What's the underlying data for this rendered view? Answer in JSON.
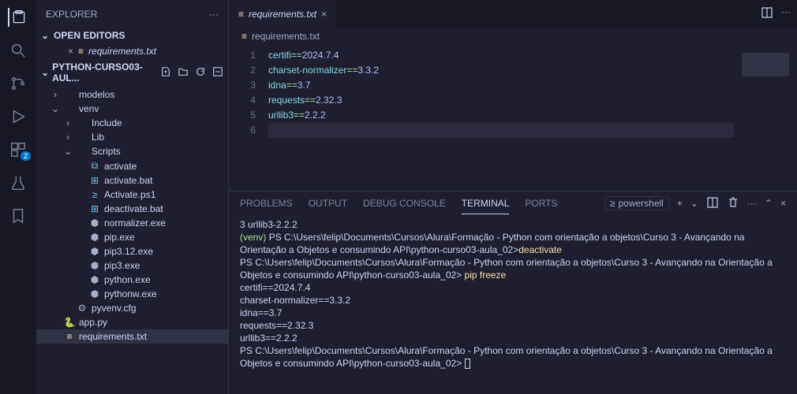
{
  "explorer": {
    "title": "EXPLORER",
    "openEditors": {
      "label": "OPEN EDITORS"
    },
    "openEditorsItems": [
      {
        "name": "requirements.txt"
      }
    ],
    "project": "PYTHON-CURSO03-AUL...",
    "tree": [
      {
        "lvl": 1,
        "chev": "›",
        "icon": "",
        "name": "modelos",
        "type": "folder"
      },
      {
        "lvl": 1,
        "chev": "⌄",
        "icon": "",
        "name": "venv",
        "type": "folder"
      },
      {
        "lvl": 2,
        "chev": "›",
        "icon": "",
        "name": "Include",
        "type": "folder"
      },
      {
        "lvl": 2,
        "chev": "›",
        "icon": "",
        "name": "Lib",
        "type": "folder"
      },
      {
        "lvl": 2,
        "chev": "⌄",
        "icon": "",
        "name": "Scripts",
        "type": "folder"
      },
      {
        "lvl": 3,
        "chev": "",
        "icon": "⧉",
        "iconColor": "#74c7ec",
        "name": "activate",
        "type": "file"
      },
      {
        "lvl": 3,
        "chev": "",
        "icon": "⊞",
        "iconColor": "#74c7ec",
        "name": "activate.bat",
        "type": "file"
      },
      {
        "lvl": 3,
        "chev": "",
        "icon": "≥",
        "iconColor": "#74c7ec",
        "name": "Activate.ps1",
        "type": "file"
      },
      {
        "lvl": 3,
        "chev": "",
        "icon": "⊞",
        "iconColor": "#74c7ec",
        "name": "deactivate.bat",
        "type": "file"
      },
      {
        "lvl": 3,
        "chev": "",
        "icon": "⬢",
        "iconColor": "#a6adc8",
        "name": "normalizer.exe",
        "type": "file"
      },
      {
        "lvl": 3,
        "chev": "",
        "icon": "⬢",
        "iconColor": "#a6adc8",
        "name": "pip.exe",
        "type": "file"
      },
      {
        "lvl": 3,
        "chev": "",
        "icon": "⬢",
        "iconColor": "#a6adc8",
        "name": "pip3.12.exe",
        "type": "file"
      },
      {
        "lvl": 3,
        "chev": "",
        "icon": "⬢",
        "iconColor": "#a6adc8",
        "name": "pip3.exe",
        "type": "file"
      },
      {
        "lvl": 3,
        "chev": "",
        "icon": "⬢",
        "iconColor": "#a6adc8",
        "name": "python.exe",
        "type": "file"
      },
      {
        "lvl": 3,
        "chev": "",
        "icon": "⬢",
        "iconColor": "#a6adc8",
        "name": "pythonw.exe",
        "type": "file"
      },
      {
        "lvl": 2,
        "chev": "",
        "icon": "⚙",
        "iconColor": "#a6adc8",
        "name": "pyvenv.cfg",
        "type": "file"
      },
      {
        "lvl": 1,
        "chev": "",
        "icon": "🐍",
        "iconColor": "#f9e2af",
        "name": "app.py",
        "type": "file"
      },
      {
        "lvl": 1,
        "chev": "",
        "icon": "≡",
        "iconColor": "#f9e2af",
        "name": "requirements.txt",
        "type": "file",
        "selected": true
      }
    ]
  },
  "editor": {
    "tab": {
      "name": "requirements.txt"
    },
    "breadcrumb": "requirements.txt",
    "lines": [
      {
        "n": 1,
        "pkg": "certifi",
        "op": "==",
        "ver": "2024.7.4"
      },
      {
        "n": 2,
        "pkg": "charset-normalizer",
        "op": "==",
        "ver": "3.3.2"
      },
      {
        "n": 3,
        "pkg": "idna",
        "op": "==",
        "ver": "3.7"
      },
      {
        "n": 4,
        "pkg": "requests",
        "op": "==",
        "ver": "2.32.3"
      },
      {
        "n": 5,
        "pkg": "urllib3",
        "op": "==",
        "ver": "2.2.2"
      },
      {
        "n": 6,
        "pkg": "",
        "op": "",
        "ver": "",
        "current": true
      }
    ]
  },
  "panel": {
    "tabs": {
      "problems": "PROBLEMS",
      "output": "OUTPUT",
      "debug": "DEBUG CONSOLE",
      "terminal": "TERMINAL",
      "ports": "PORTS"
    },
    "shell": "powershell",
    "terminalLines": [
      {
        "segments": [
          {
            "text": "3 urllib3-2.2.2"
          }
        ]
      },
      {
        "segments": [
          {
            "text": "(venv) ",
            "cls": "t-green"
          },
          {
            "text": "PS C:\\Users\\felip\\Documents\\Cursos\\Alura\\Formação - Python com orientação a objetos\\Curso 3 - Avançando na Orientação a Objetos e consumindo API\\python-curso03-aula_02>"
          },
          {
            "text": "deactivate",
            "cls": "t-yellow"
          }
        ]
      },
      {
        "segments": [
          {
            "text": "PS C:\\Users\\felip\\Documents\\Cursos\\Alura\\Formação - Python com orientação a objetos\\Curso 3 - Avançando na Orientação a Objetos e consumindo API\\python-curso03-aula_02> "
          },
          {
            "text": "pip freeze",
            "cls": "t-yellow"
          }
        ]
      },
      {
        "segments": [
          {
            "text": "certifi==2024.7.4"
          }
        ]
      },
      {
        "segments": [
          {
            "text": "charset-normalizer==3.3.2"
          }
        ]
      },
      {
        "segments": [
          {
            "text": "idna==3.7"
          }
        ]
      },
      {
        "segments": [
          {
            "text": "requests==2.32.3"
          }
        ]
      },
      {
        "segments": [
          {
            "text": "urllib3==2.2.2"
          }
        ]
      },
      {
        "segments": [
          {
            "text": "PS C:\\Users\\felip\\Documents\\Cursos\\Alura\\Formação - Python com orientação a objetos\\Curso 3 - Avançando na Orientação a Objetos e consumindo API\\python-curso03-aula_02> "
          }
        ],
        "cursor": true
      }
    ]
  },
  "activityBadge": "2"
}
